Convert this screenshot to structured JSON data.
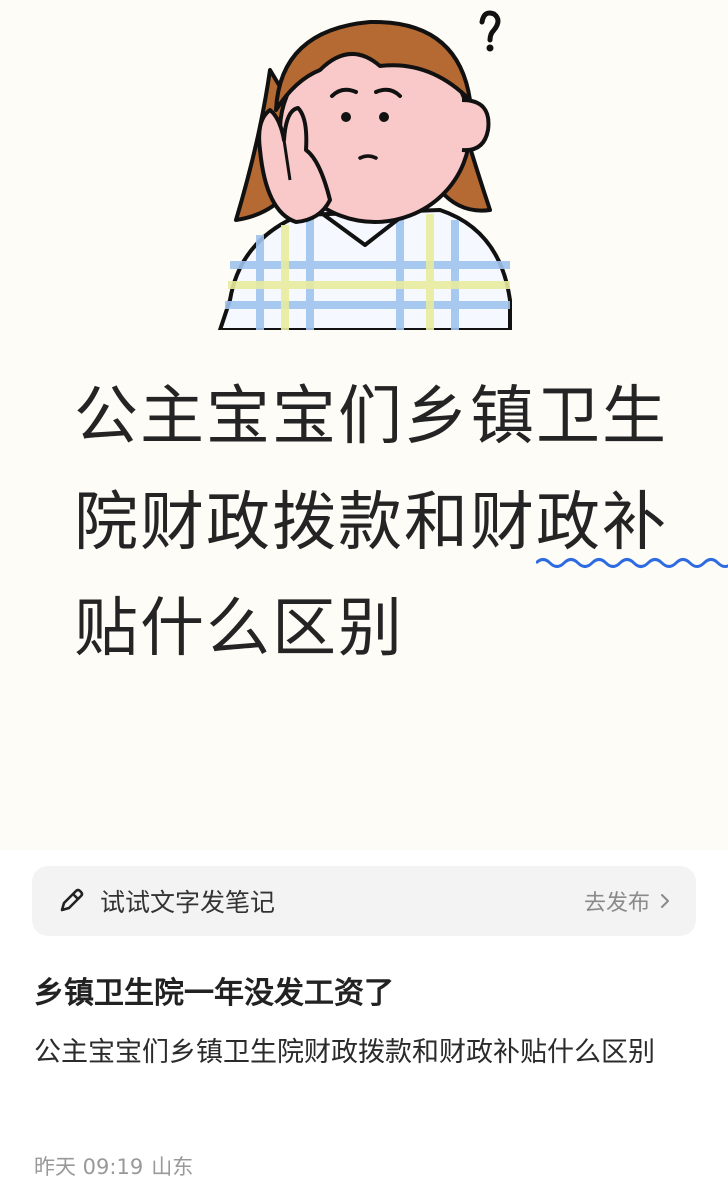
{
  "note_card": {
    "headline_part1": "公主宝宝们乡镇",
    "headline_underlined": "卫生院",
    "headline_part2": "财政拨款和财政补贴什么区别",
    "underline_color": "#2f6be0",
    "illustration": "worried-girl-illustration"
  },
  "compose": {
    "icon": "pencil-icon",
    "hint": "试试文字发笔记",
    "publish_label": "去发布",
    "publish_icon": "chevron-right-icon"
  },
  "post": {
    "title": "乡镇卫生院一年没发工资了",
    "body": "公主宝宝们乡镇卫生院财政拨款和财政补贴什么区别",
    "date": "昨天 09:19",
    "location": "山东"
  }
}
